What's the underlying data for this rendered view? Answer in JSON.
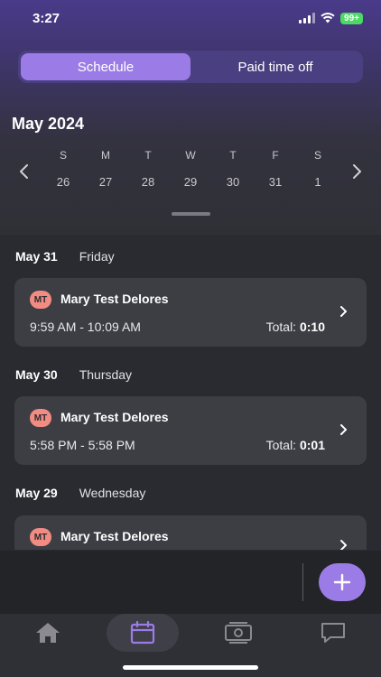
{
  "status": {
    "time": "3:27",
    "battery": "99+"
  },
  "segmented": {
    "schedule_label": "Schedule",
    "pto_label": "Paid time off",
    "active": "schedule"
  },
  "calendar": {
    "month_title": "May 2024",
    "days": [
      {
        "letter": "S",
        "num": "26"
      },
      {
        "letter": "M",
        "num": "27"
      },
      {
        "letter": "T",
        "num": "28"
      },
      {
        "letter": "W",
        "num": "29"
      },
      {
        "letter": "T",
        "num": "30"
      },
      {
        "letter": "F",
        "num": "31"
      },
      {
        "letter": "S",
        "num": "1"
      }
    ]
  },
  "entries": [
    {
      "date": "May 31",
      "weekday": "Friday",
      "initials": "MT",
      "name": "Mary Test Delores",
      "range": "9:59 AM - 10:09 AM",
      "total_label": "Total:",
      "total_value": "0:10"
    },
    {
      "date": "May 30",
      "weekday": "Thursday",
      "initials": "MT",
      "name": "Mary Test Delores",
      "range": "5:58 PM - 5:58 PM",
      "total_label": "Total:",
      "total_value": "0:01"
    },
    {
      "date": "May 29",
      "weekday": "Wednesday",
      "initials": "MT",
      "name": "Mary Test Delores"
    }
  ],
  "colors": {
    "accent": "#9b7ce6",
    "avatar": "#f28b82",
    "card": "#3d3e44"
  },
  "tabs": [
    {
      "icon": "home-icon",
      "active": false
    },
    {
      "icon": "calendar-icon",
      "active": true
    },
    {
      "icon": "money-icon",
      "active": false
    },
    {
      "icon": "chat-icon",
      "active": false
    }
  ]
}
